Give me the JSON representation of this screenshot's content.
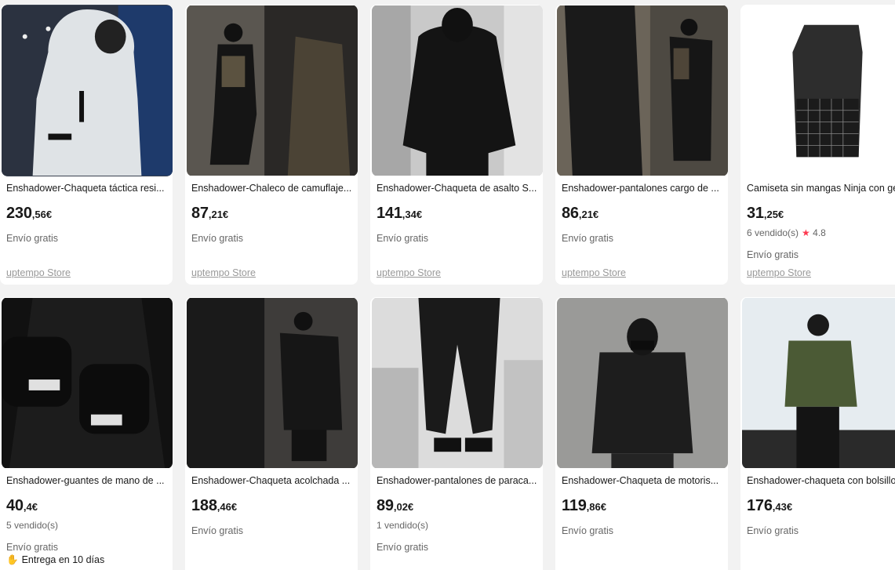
{
  "products": [
    {
      "title": "Enshadower-Chaqueta táctica resi...",
      "price_int": "230",
      "price_dec": ",56€",
      "shipping": "Envío gratis",
      "store": "uptempo Store"
    },
    {
      "title": "Enshadower-Chaleco de camuflaje...",
      "price_int": "87",
      "price_dec": ",21€",
      "shipping": "Envío gratis",
      "store": "uptempo Store"
    },
    {
      "title": "Enshadower-Chaqueta de asalto S...",
      "price_int": "141",
      "price_dec": ",34€",
      "shipping": "Envío gratis",
      "store": "uptempo Store"
    },
    {
      "title": "Enshadower-pantalones cargo de ...",
      "price_int": "86",
      "price_dec": ",21€",
      "shipping": "Envío gratis",
      "store": "uptempo Store"
    },
    {
      "title": "Camiseta sin mangas Ninja con ge",
      "price_int": "31",
      "price_dec": ",25€",
      "sold": "6 vendido(s)",
      "rating": "4.8",
      "shipping": "Envío gratis",
      "store": "uptempo Store"
    },
    {
      "title": "Enshadower-guantes de mano de ...",
      "price_int": "40",
      "price_dec": ",4€",
      "sold": "5 vendido(s)",
      "shipping": "Envío gratis",
      "delivery": "Entrega en 10 días"
    },
    {
      "title": "Enshadower-Chaqueta acolchada ...",
      "price_int": "188",
      "price_dec": ",46€",
      "shipping": "Envío gratis"
    },
    {
      "title": "Enshadower-pantalones de paraca...",
      "price_int": "89",
      "price_dec": ",02€",
      "sold": "1 vendido(s)",
      "shipping": "Envío gratis"
    },
    {
      "title": "Enshadower-Chaqueta de motoris...",
      "price_int": "119",
      "price_dec": ",86€",
      "shipping": "Envío gratis"
    },
    {
      "title": "Enshadower-chaqueta con bolsillo",
      "price_int": "176",
      "price_dec": ",43€",
      "shipping": "Envío gratis"
    }
  ],
  "icons": {
    "rating": "star-icon",
    "delivery": "hand-icon"
  },
  "colors": {
    "price": "#191919",
    "muted": "#666666",
    "store": "#999999",
    "star": "#fd384f",
    "background": "#f2f2f2"
  }
}
